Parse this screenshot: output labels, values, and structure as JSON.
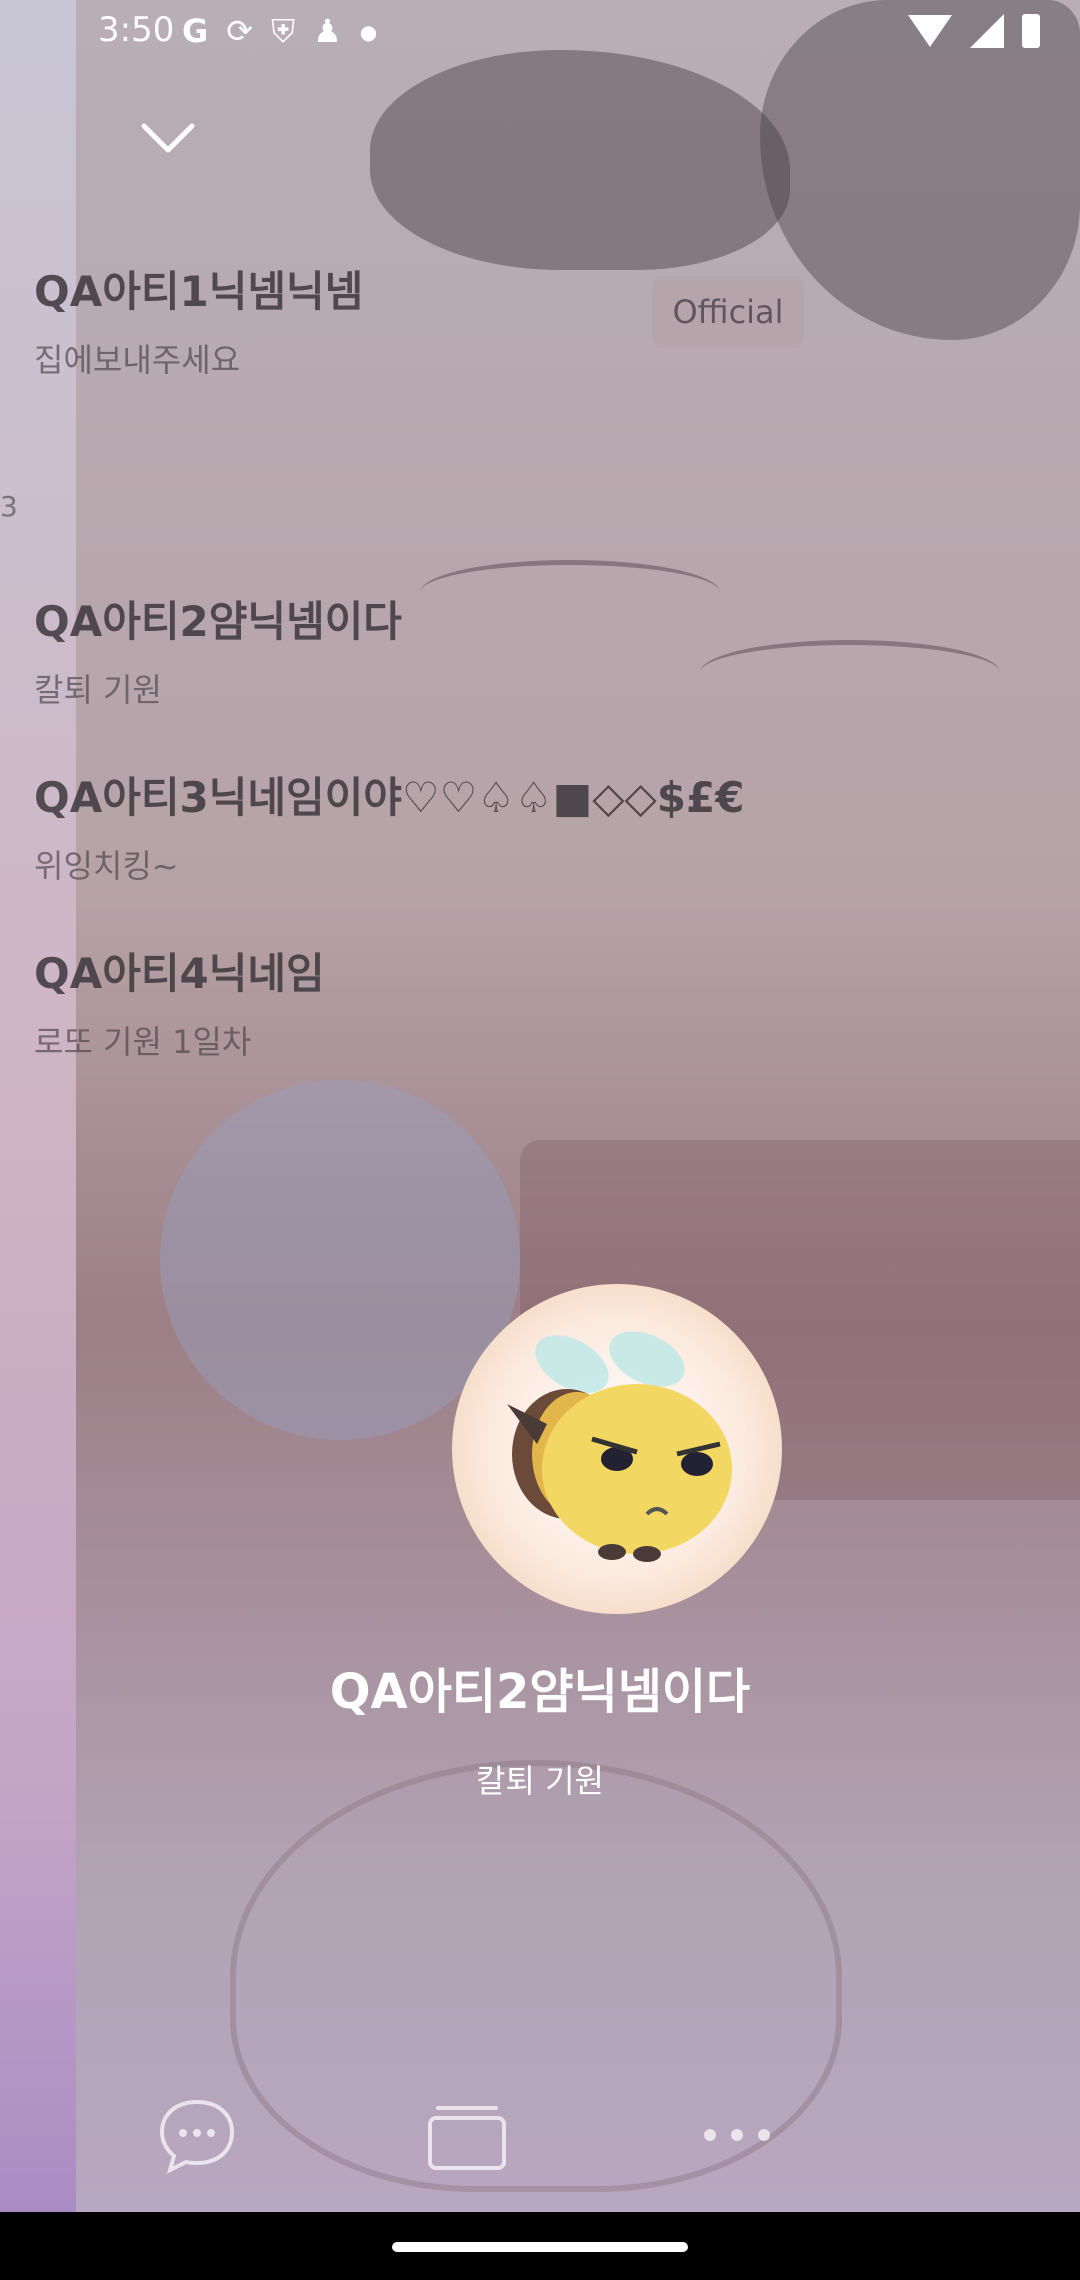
{
  "status_bar": {
    "time": "3:50",
    "left_icons": [
      "google-icon",
      "sync-icon",
      "shield-icon",
      "person-icon",
      "dot-icon"
    ],
    "right_icons": [
      "wifi-icon",
      "signal-icon",
      "battery-icon"
    ]
  },
  "list": {
    "items": [
      {
        "nickname": "QA아티1닉넴닉넴",
        "status": "집에보내주세요",
        "badge": "Official"
      },
      {
        "nickname": "QA아티2얌닉넴이다",
        "status": "칼퇴 기원"
      },
      {
        "nickname": "QA아티3닉네임이야♡♡♤♤■◇◇$£€",
        "status": "위잉치킹~"
      },
      {
        "nickname": "QA아티4닉네임",
        "status": "로또 기원 1일차"
      }
    ],
    "edge_number": "3"
  },
  "profile": {
    "name": "QA아티2얌닉넴이다",
    "status": "칼퇴 기원",
    "avatar_icon": "bee-character-icon"
  },
  "bottom_actions": [
    "chat-icon",
    "card-icon",
    "more-icon"
  ],
  "colors": {
    "text_light": "#ffffff",
    "badge_bg": "#b4a5aa"
  }
}
